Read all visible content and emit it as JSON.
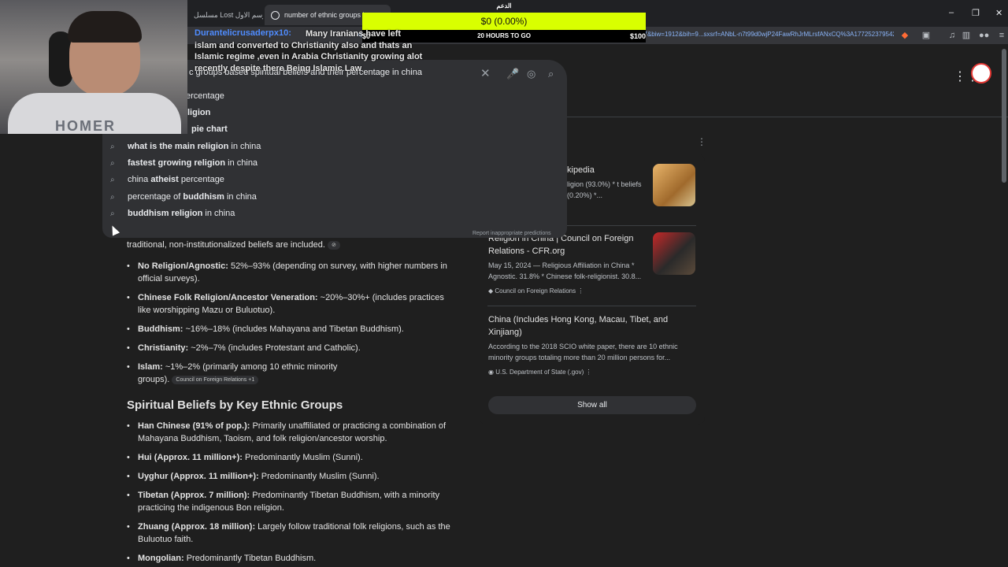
{
  "browser": {
    "tabs": [
      {
        "label": "مسلسل Lost الموسم الاول"
      },
      {
        "label": "number of ethnic groups bas"
      }
    ],
    "url": "q=ethnic+groups+based+spiritual+beliefs+and+their+percentage+in+china&oq=...&gs_lcrp=...a0071c17&biw=1912&bih=9...sxsrf=ANbL-n7t99d0wjP24FawRhJrMLrsfANxCQ%3A1772523795426&ei=...",
    "window_buttons": {
      "minimize": "–",
      "maximize": "❐",
      "close": "✕"
    }
  },
  "search": {
    "query": "c groups based spiritual beliefs and their percentage in china",
    "suggestions": [
      {
        "pre": "",
        "bold": "",
        "post": "ercentage"
      },
      {
        "pre": "",
        "bold": "ligion",
        "post": ""
      },
      {
        "pre": "",
        "bold": "pie chart",
        "post": ""
      },
      {
        "pre": "",
        "bold": "what is the main religion",
        "post": " in china"
      },
      {
        "pre": "",
        "bold": "fastest growing religion",
        "post": " in china"
      },
      {
        "pre": "china ",
        "bold": "atheist",
        "post": " percentage"
      },
      {
        "pre": "percentage of ",
        "bold": "buddhism",
        "post": " in china"
      },
      {
        "pre": "",
        "bold": "buddhism religion",
        "post": " in china"
      }
    ],
    "report": "Report inappropriate predictions"
  },
  "overview": {
    "intro": "traditional, non-institutionalized beliefs are included.",
    "items": [
      {
        "label": "No Religion/Agnostic:",
        "text": " 52%–93% (depending on survey, with higher numbers in official surveys)."
      },
      {
        "label": "Chinese Folk Religion/Ancestor Veneration:",
        "text": " ~20%–30%+ (includes practices like worshipping Mazu or Buluotuo)."
      },
      {
        "label": "Buddhism:",
        "text": " ~16%–18% (includes Mahayana and Tibetan Buddhism)."
      },
      {
        "label": "Christianity:",
        "text": " ~2%–7% (includes Protestant and Catholic)."
      },
      {
        "label": "Islam:",
        "text": " ~1%–2% (primarily among 10 ethnic minority groups). ",
        "cite": "Council on Foreign Relations +1"
      }
    ],
    "section_title": "Spiritual Beliefs by Key Ethnic Groups",
    "groups": [
      {
        "label": "Han Chinese (91% of pop.):",
        "text": " Primarily unaffiliated or practicing a combination of Mahayana Buddhism, Taoism, and folk religion/ancestor worship."
      },
      {
        "label": "Hui (Approx. 11 million+):",
        "text": " Predominantly Muslim (Sunni)."
      },
      {
        "label": "Uyghur (Approx. 11 million+):",
        "text": " Predominantly Muslim (Sunni)."
      },
      {
        "label": "Tibetan (Approx. 7 million):",
        "text": " Predominantly Tibetan Buddhism, with a minority practicing the indigenous Bon religion."
      },
      {
        "label": "Zhuang (Approx. 18 million):",
        "text": " Largely follow traditional folk religions, such as the Buluotuo faith."
      },
      {
        "label": "Mongolian:",
        "text": " Predominantly Tibetan Buddhism."
      }
    ]
  },
  "sources": {
    "items": [
      {
        "title": "kipedia",
        "snippet": "ligion (93.0%) * t beliefs (0.20%) *...",
        "site": ""
      },
      {
        "title": "Religion in China | Council on Foreign Relations - CFR.org",
        "snippet": "May 15, 2024 — Religious Affiliation in China * Agnostic. 31.8% * Chinese folk-religionist. 30.8...",
        "site": "Council on Foreign Relations"
      },
      {
        "title": "China (Includes Hong Kong, Macau, Tibet, and Xinjiang)",
        "snippet": "According to the 2018 SCIO white paper, there are 10 ethnic minority groups totaling more than 20 million persons for...",
        "site": "U.S. Department of State (.gov)"
      }
    ],
    "show_all": "Show all"
  },
  "stream": {
    "chat_user": "Durantelicrusaderpx10:",
    "chat_text": "Many Iranians have left islam and converted to Christianity also and thats an Islamic regime ,even in Arabia Christianity growing alot recently despite there Being Islamic Law",
    "webcam_shirt": "HOMER",
    "goal": {
      "title": "الدعم",
      "status": "$0 (0.00%)",
      "progress": 0.0,
      "min": "$0",
      "time_left": "20 HOURS TO GO",
      "max": "$100"
    }
  },
  "colors": {
    "accent": "#8ab4f8",
    "goal": "#d9ff00",
    "chat_name": "#4f8cff"
  }
}
